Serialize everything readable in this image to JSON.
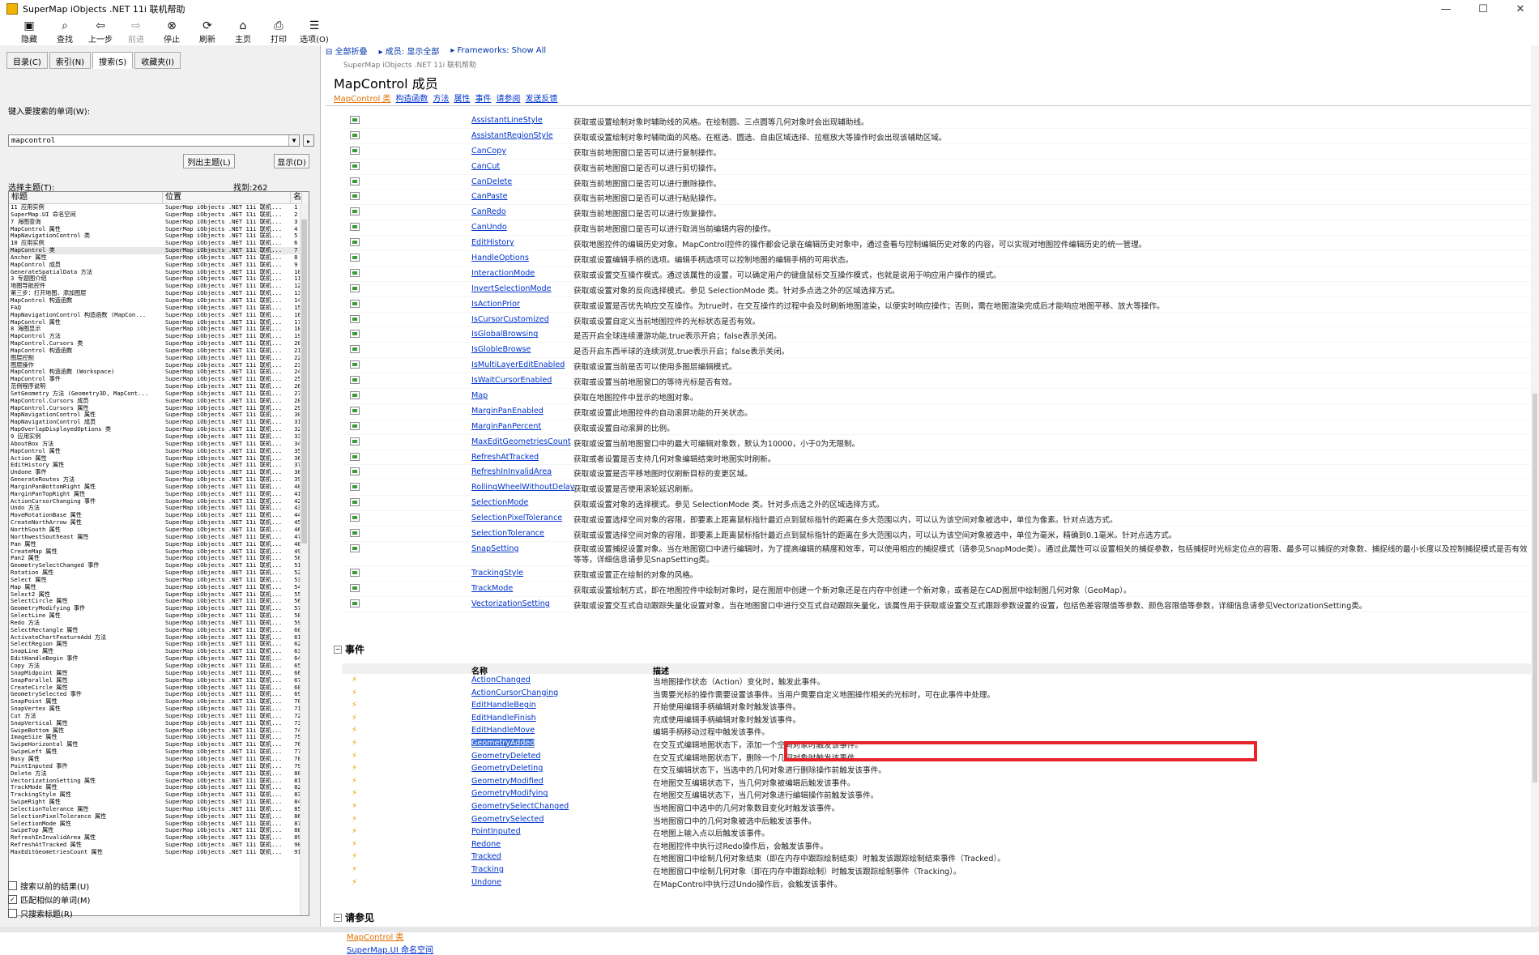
{
  "window": {
    "title": "SuperMap iObjects .NET 11i 联机帮助"
  },
  "toolbar": [
    {
      "label": "隐藏",
      "icon": "hide-icon",
      "glyph": "▣",
      "enabled": true
    },
    {
      "label": "查找",
      "icon": "find-icon",
      "glyph": "⌕",
      "enabled": true
    },
    {
      "label": "上一步",
      "icon": "back-icon",
      "glyph": "⇦",
      "enabled": true
    },
    {
      "label": "前进",
      "icon": "forward-icon",
      "glyph": "⇨",
      "enabled": false
    },
    {
      "label": "停止",
      "icon": "stop-icon",
      "glyph": "⊗",
      "enabled": true
    },
    {
      "label": "刷新",
      "icon": "refresh-icon",
      "glyph": "⟳",
      "enabled": true
    },
    {
      "label": "主页",
      "icon": "home-icon",
      "glyph": "⌂",
      "enabled": true
    },
    {
      "label": "打印",
      "icon": "print-icon",
      "glyph": "⎙",
      "enabled": true
    },
    {
      "label": "选项(O)",
      "icon": "options-icon",
      "glyph": "☰",
      "enabled": true
    }
  ],
  "left": {
    "tabs": [
      "目录(C)",
      "索引(N)",
      "搜索(S)",
      "收藏夹(I)"
    ],
    "active_tab": 2,
    "search_label": "键入要搜索的单词(W):",
    "search_value": "mapcontrol",
    "list_topics_button": "列出主题(L)",
    "display_button": "显示(D)",
    "select_topic_label": "选择主题(T):",
    "found_label": "找到:262",
    "columns": [
      "标题",
      "位置",
      "名"
    ],
    "location_text": "SuperMap iObjects .NET 11i 联机...",
    "rows": [
      "11 应用实例",
      "SuperMap.UI 命名空间",
      "7 海图查询",
      "MapControl 属性",
      "MapNavigationControl 类",
      "10 应用实例",
      "MapControl 类",
      "Anchor 属性",
      "MapControl 成员",
      "GenerateSpatialData 方法",
      "3 专题图介绍",
      "地图导航控件",
      "第三步：打开地图、添加图层",
      "MapControl 构造函数",
      "FAQ",
      "MapNavigationControl 构造函数 (MapCon...",
      "MapControl 属性",
      "8 海图显示",
      "MapControl 方法",
      "MapControl.Cursors 类",
      "MapControl 构造函数",
      "图层控制",
      "图层操作",
      "MapControl 构造函数 (Workspace)",
      "MapControl 事件",
      "范例程序说明",
      "SetGeometry 方法 (Geometry3D, MapCont...",
      "MapControl.Cursors 成员",
      "MapControl.Cursors 属性",
      "MapNavigationControl 属性",
      "MapNavigationControl 成员",
      "MapOverlapDisplayedOptions 类",
      "9 应用实例",
      "AboutBox 方法",
      "MapControl 属性",
      "Action 属性",
      "EditHistory 属性",
      "Undone 事件",
      "GenerateRoutes 方法",
      "MarginPanBottomRight 属性",
      "MarginPanTopRight 属性",
      "ActionCursorChanging 事件",
      "Undo 方法",
      "MoveRotationBase 属性",
      "CreateNorthArrow 属性",
      "NorthSouth 属性",
      "NorthwestSoutheast 属性",
      "Pan 属性",
      "CreateMap 属性",
      "Pan2 属性",
      "GeometrySelectChanged 事件",
      "Rotation 属性",
      "Select 属性",
      "Map 属性",
      "Select2 属性",
      "SelectCircle 属性",
      "GeometryModifying 事件",
      "SelectLine 属性",
      "Redo 方法",
      "SelectRectangle 属性",
      "ActivateChartFeatureAdd 方法",
      "SelectRegion 属性",
      "SnapLine 属性",
      "EditHandleBegin 事件",
      "Copy 方法",
      "SnapMidpoint 属性",
      "SnapParallel 属性",
      "CreateCircle 属性",
      "GeometrySelected 事件",
      "SnapPoint 属性",
      "SnapVertex 属性",
      "Cut 方法",
      "SnapVertical 属性",
      "SwipeBottom 属性",
      "ImageSize 属性",
      "SwipeHorizontal 属性",
      "SwipeLeft 属性",
      "Busy 属性",
      "PointInputed 事件",
      "Delete 方法",
      "VectorizationSetting 属性",
      "TrackMode 属性",
      "TrackingStyle 属性",
      "SwipeRight 属性",
      "SelectionTolerance 属性",
      "SelectionPixelTolerance 属性",
      "SelectionMode 属性",
      "SwipeTop 属性",
      "RefreshInInvalidArea 属性",
      "RefreshAtTracked 属性",
      "MaxEditGeometriesCount 属性"
    ],
    "selected_row": 6,
    "checkboxes": [
      {
        "label": "搜索以前的结果(U)",
        "checked": false
      },
      {
        "label": "匹配相似的单词(M)",
        "checked": true
      },
      {
        "label": "只搜索标题(R)",
        "checked": false
      }
    ]
  },
  "content": {
    "nav": [
      "全部折叠",
      "成员: 显示全部",
      "Frameworks: Show All"
    ],
    "subtitle": "SuperMap iObjects .NET 11i 联机帮助",
    "title": "MapControl 成员",
    "member_links": [
      "MapControl 类",
      "构造函数",
      "方法",
      "属性",
      "事件",
      "请参阅",
      "发送反馈"
    ],
    "properties": [
      {
        "name": "AssistantLineStyle",
        "desc": "获取或设置绘制对象时辅助线的风格。在绘制圆、三点圆等几何对象时会出现辅助线。"
      },
      {
        "name": "AssistantRegionStyle",
        "desc": "获取或设置绘制对象时辅助面的风格。在框选、圆选、自由区域选择、拉框放大等操作时会出现该辅助区域。"
      },
      {
        "name": "CanCopy",
        "desc": "获取当前地图窗口是否可以进行复制操作。"
      },
      {
        "name": "CanCut",
        "desc": "获取当前地图窗口是否可以进行剪切操作。"
      },
      {
        "name": "CanDelete",
        "desc": "获取当前地图窗口是否可以进行删除操作。"
      },
      {
        "name": "CanPaste",
        "desc": "获取当前地图窗口是否可以进行粘贴操作。"
      },
      {
        "name": "CanRedo",
        "desc": "获取当前地图窗口是否可以进行恢复操作。"
      },
      {
        "name": "CanUndo",
        "desc": "获取当前地图窗口是否可以进行取消当前编辑内容的操作。"
      },
      {
        "name": "EditHistory",
        "desc": "获取地图控件的编辑历史对象。MapControl控件的操作都会记录在编辑历史对象中，通过查看与控制编辑历史对象的内容，可以实现对地图控件编辑历史的统一管理。"
      },
      {
        "name": "HandleOptions",
        "desc": "获取或设置编辑手柄的选项。编辑手柄选项可以控制地图的编辑手柄的可用状态。"
      },
      {
        "name": "InteractionMode",
        "desc": "获取或设置交互操作模式。通过该属性的设置，可以确定用户的键盘鼠标交互操作模式，也就是说用于响应用户操作的模式。"
      },
      {
        "name": "InvertSelectionMode",
        "desc": "获取或设置对象的反向选择模式。参见 SelectionMode 类。针对多点选之外的区域选择方式。"
      },
      {
        "name": "IsActionPrior",
        "desc": "获取或设置是否优先响应交互操作。为true时，在交互操作的过程中会及时刷新地图渲染，以便实时响应操作；否则，需在地图渲染完成后才能响应地图平移、放大等操作。"
      },
      {
        "name": "IsCursorCustomized",
        "desc": "获取或设置自定义当前地图控件的光标状态是否有效。"
      },
      {
        "name": "IsGlobalBrowsing",
        "desc": "是否开启全球连续漫游功能,true表示开启；false表示关闭。"
      },
      {
        "name": "IsGlobleBrowse",
        "desc": "是否开启东西半球的连续浏览,true表示开启；false表示关闭。"
      },
      {
        "name": "IsMultiLayerEditEnabled",
        "desc": "获取或设置当前是否可以使用多图层编辑模式。"
      },
      {
        "name": "IsWaitCursorEnabled",
        "desc": "获取或设置当前地图窗口的等待光标是否有效。"
      },
      {
        "name": "Map",
        "desc": "获取在地图控件中显示的地图对象。"
      },
      {
        "name": "MarginPanEnabled",
        "desc": "获取或设置此地图控件的自动滚屏功能的开关状态。"
      },
      {
        "name": "MarginPanPercent",
        "desc": "获取或设置自动滚屏的比例。"
      },
      {
        "name": "MaxEditGeometriesCount",
        "desc": "获取或设置当前地图窗口中的最大可编辑对象数，默认为10000，小于0为无限制。"
      },
      {
        "name": "RefreshAtTracked",
        "desc": "获取或者设置是否支持几何对象编辑结束时地图实时刷新。"
      },
      {
        "name": "RefreshInInvalidArea",
        "desc": "获取或设置是否平移地图时仅刷新目标的变更区域。"
      },
      {
        "name": "RollingWheelWithoutDelay",
        "desc": "获取或设置是否使用滚轮延迟刷新。"
      },
      {
        "name": "SelectionMode",
        "desc": "获取或设置对象的选择模式。参见 SelectionMode 类。针对多点选之外的区域选择方式。"
      },
      {
        "name": "SelectionPixelTolerance",
        "desc": "获取或设置选择空间对象的容限，即要素上距离鼠标指针最近点到鼠标指针的距离在多大范围以内，可以认为该空间对象被选中，单位为像素。针对点选方式。"
      },
      {
        "name": "SelectionTolerance",
        "desc": "获取或设置选择空间对象的容限，即要素上距离鼠标指针最近点到鼠标指针的距离在多大范围以内，可以认为该空间对象被选中，单位为毫米，精确到0.1毫米。针对点选方式。"
      },
      {
        "name": "SnapSetting",
        "desc": "获取或设置捕捉设置对象。当在地图窗口中进行编辑时，为了提高编辑的精度和效率，可以使用相应的捕捉模式（请参见SnapMode类）。通过此属性可以设置相关的捕捉参数，包括捕捉时光标定位点的容限、最多可以捕捉的对象数、捕捉线的最小长度以及控制捕捉模式是否有效等等，详细信息请参见SnapSetting类。",
        "tall": true
      },
      {
        "name": "TrackingStyle",
        "desc": "获取或设置正在绘制的对象的风格。"
      },
      {
        "name": "TrackMode",
        "desc": "获取或设置绘制方式，即在地图控件中绘制对象时，是在图层中创建一个新对象还是在内存中创建一个新对象，或者是在CAD图层中绘制图几何对象（GeoMap）。"
      },
      {
        "name": "VectorizationSetting",
        "desc": "获取或设置交互式自动跟踪失量化设置对象，当在地图窗口中进行交互式自动跟踪矢量化，该属性用于获取或设置交互式跟踪参数设置的设置，包括色差容限值等参数、颜色容限值等参数，详细信息请参见VectorizationSetting类。"
      }
    ],
    "events_section": "事件",
    "events_cols": [
      "名称",
      "描述"
    ],
    "events": [
      {
        "name": "ActionChanged",
        "desc": "当地图操作状态（Action）变化时，触发此事件。"
      },
      {
        "name": "ActionCursorChanging",
        "desc": "当需要光标的操作需要设置该事件。当用户需要自定义地图操作相关的光标时，可在此事件中处理。"
      },
      {
        "name": "EditHandleBegin",
        "desc": "开始使用编辑手柄编辑对象时触发该事件。"
      },
      {
        "name": "EditHandleFinish",
        "desc": "完成使用编辑手柄编辑对象时触发该事件。"
      },
      {
        "name": "EditHandleMove",
        "desc": "编辑手柄移动过程中触发该事件。"
      },
      {
        "name": "GeometryAdded",
        "desc": "在交互式编辑地图状态下，添加一个空间对象时触发该事件。"
      },
      {
        "name": "GeometryDeleted",
        "desc": "在交互式编辑地图状态下，删除一个几何对象时触发该事件。"
      },
      {
        "name": "GeometryDeleting",
        "desc": "在交互编辑状态下，当选中的几何对象进行删除操作前触发该事件。"
      },
      {
        "name": "GeometryModified",
        "desc": "在地图交互编辑状态下，当几何对象被编辑后触发该事件。"
      },
      {
        "name": "GeometryModifying",
        "desc": "在地图交互编辑状态下，当几何对象进行编辑操作前触发该事件。"
      },
      {
        "name": "GeometrySelectChanged",
        "desc": "当地图窗口中选中的几何对象数目变化时触发该事件。"
      },
      {
        "name": "GeometrySelected",
        "desc": "当地图窗口中的几何对象被选中后触发该事件。"
      },
      {
        "name": "PointInputed",
        "desc": "在地图上输入点以后触发该事件。"
      },
      {
        "name": "Redone",
        "desc": "在地图控件中执行过Redo操作后，会触发该事件。"
      },
      {
        "name": "Tracked",
        "desc": "在地图窗口中绘制几何对象结束（即在内存中跟踪绘制结束）时触发该跟踪绘制结束事件（Tracked）。"
      },
      {
        "name": "Tracking",
        "desc": "在地图窗口中绘制几何对象（即在内存中跟踪绘制）时触发该跟踪绘制事件（Tracking）。"
      },
      {
        "name": "Undone",
        "desc": "在MapControl中执行过Undo操作后，会触发该事件。"
      }
    ],
    "highlighted_event": 5,
    "seealso_section": "请参见",
    "seealso": [
      "MapControl 类",
      "SuperMap.UI 命名空间"
    ]
  },
  "colors": {
    "link": "#0033cc",
    "current_link": "#e07000",
    "highlight_box": "#e8232a",
    "selection": "#3a6ed8"
  }
}
